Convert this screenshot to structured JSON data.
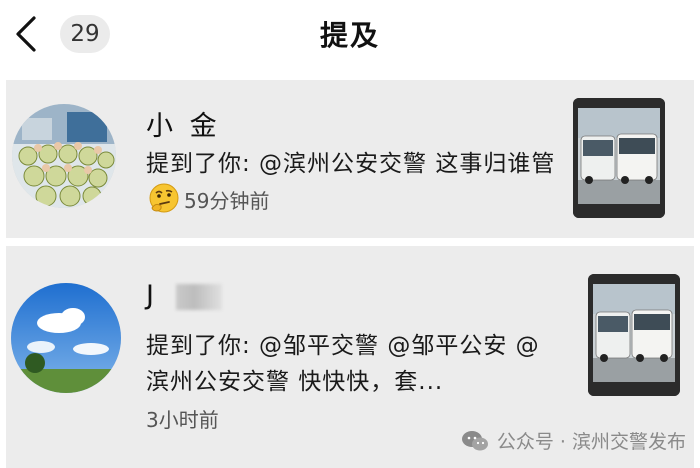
{
  "header": {
    "back_icon": "chevron-left-icon",
    "count": "29",
    "title": "提及"
  },
  "mentions": [
    {
      "username": "小 金",
      "message": "提到了你: @滨州公安交警 这事归谁管",
      "emoji": "thinking-face-emoji",
      "time": "59分钟前",
      "thumbnail": "minibus-photo"
    },
    {
      "username": "J",
      "username_masked": true,
      "message": "提到了你: @邹平交警 @邹平公安 @滨州公安交警 快快快，套...",
      "time": "3小时前",
      "thumbnail": "minibus-photo"
    }
  ],
  "watermark": {
    "icon": "wechat-icon",
    "text": "公众号 · 滨州交警发布"
  }
}
